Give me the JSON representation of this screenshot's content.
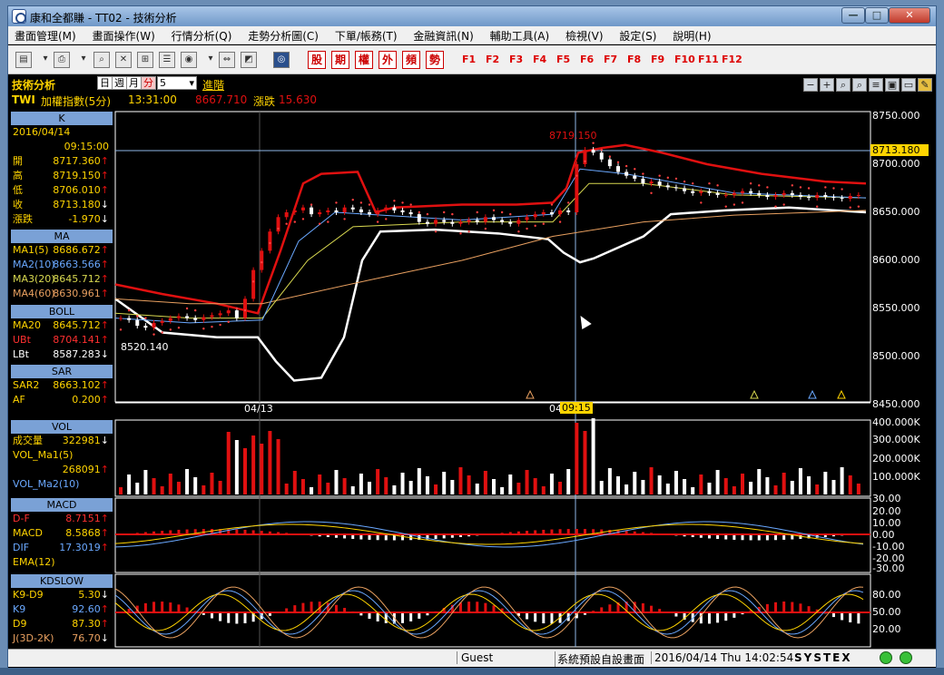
{
  "window": {
    "title": "康和全都賺 - TT02 - 技術分析",
    "controls": {
      "minimize": "—",
      "maximize": "□",
      "close": "✕"
    }
  },
  "menu": [
    "畫面管理(M)",
    "畫面操作(W)",
    "行情分析(Q)",
    "走勢分析圖(C)",
    "下單/帳務(T)",
    "金融資訊(N)",
    "輔助工具(A)",
    "檢視(V)",
    "設定(S)",
    "說明(H)"
  ],
  "toolbar": {
    "red_buttons": [
      "股",
      "期",
      "權",
      "外",
      "頻",
      "勢"
    ],
    "fkeys": [
      "F1",
      "F2",
      "F3",
      "F4",
      "F5",
      "F6",
      "F7",
      "F8",
      "F9",
      "F10",
      "F11",
      "F12"
    ]
  },
  "info": {
    "section_title": "技術分析",
    "periods": [
      "日",
      "週",
      "月",
      "分"
    ],
    "selected_period": "分",
    "interval_value": "5",
    "advanced_label": "進階",
    "symbol": "TWI",
    "instrument": "加權指數(5分)",
    "time": "13:31:00",
    "price": "8667.710",
    "change_label": "漲跌",
    "change_value": "15.630"
  },
  "panels": {
    "k": {
      "title": "K",
      "date": "2016/04/14",
      "time": "09:15:00",
      "rows": [
        {
          "k": "開",
          "v": "8717.360",
          "arrow": "↑"
        },
        {
          "k": "高",
          "v": "8719.150",
          "arrow": "↑"
        },
        {
          "k": "低",
          "v": "8706.010",
          "arrow": "↑"
        },
        {
          "k": "收",
          "v": "8713.180",
          "arrow": "↓"
        },
        {
          "k": "漲跌",
          "v": "-1.970",
          "arrow": "↓"
        }
      ]
    },
    "ma": {
      "title": "MA",
      "rows": [
        {
          "k": "MA1(5)",
          "v": "8686.672",
          "arrow": "↑",
          "color": "#ffd400"
        },
        {
          "k": "MA2(10)",
          "v": "8663.566",
          "arrow": "↑",
          "color": "#6aa8ff"
        },
        {
          "k": "MA3(20)",
          "v": "8645.712",
          "arrow": "↑",
          "color": "#d8d850"
        },
        {
          "k": "MA4(60)",
          "v": "8630.961",
          "arrow": "↑",
          "color": "#e9a060"
        }
      ]
    },
    "boll": {
      "title": "BOLL",
      "rows": [
        {
          "k": "MA20",
          "v": "8645.712",
          "arrow": "↑",
          "color": "#ffd400"
        },
        {
          "k": "UBt",
          "v": "8704.141",
          "arrow": "↑",
          "color": "#ff3030"
        },
        {
          "k": "LBt",
          "v": "8587.283",
          "arrow": "↓",
          "color": "#ffffff"
        }
      ]
    },
    "sar": {
      "title": "SAR",
      "rows": [
        {
          "k": "SAR2",
          "v": "8663.102",
          "arrow": "↑",
          "color": "#ffd400"
        },
        {
          "k": "AF",
          "v": "0.200",
          "arrow": "↑",
          "color": "#ffd400"
        }
      ]
    },
    "vol": {
      "title": "VOL",
      "rows": [
        {
          "k": "成交量",
          "v": "322981",
          "arrow": "↓",
          "color": "#ffd400"
        },
        {
          "k": "VOL_Ma1(5)",
          "v": "",
          "arrow": "",
          "color": "#ffd400"
        },
        {
          "k": "",
          "v": "268091",
          "arrow": "↑",
          "color": "#ffd400"
        },
        {
          "k": "VOL_Ma2(10)",
          "v": "",
          "arrow": "",
          "color": "#6aa8ff"
        }
      ]
    },
    "macd": {
      "title": "MACD",
      "rows": [
        {
          "k": "D-F",
          "v": "8.7151",
          "arrow": "↑",
          "color": "#ff3030"
        },
        {
          "k": "MACD",
          "v": "8.5868",
          "arrow": "↑",
          "color": "#ffd400"
        },
        {
          "k": "DIF",
          "v": "17.3019",
          "arrow": "↑",
          "color": "#6aa8ff"
        },
        {
          "k": "EMA(12)",
          "v": "",
          "arrow": "",
          "color": "#ffd400"
        }
      ]
    },
    "kd": {
      "title": "KDSLOW",
      "rows": [
        {
          "k": "K9-D9",
          "v": "5.30",
          "arrow": "↓",
          "color": "#ffd400"
        },
        {
          "k": "K9",
          "v": "92.60",
          "arrow": "↑",
          "color": "#6aa8ff"
        },
        {
          "k": "D9",
          "v": "87.30",
          "arrow": "↑",
          "color": "#ffd400"
        },
        {
          "k": "J(3D-2K)",
          "v": "76.70",
          "arrow": "↓",
          "color": "#e9a060"
        }
      ]
    }
  },
  "price_axis": {
    "ticks": [
      "8750.000",
      "8700.000",
      "8650.000",
      "8600.000",
      "8550.000",
      "8500.000",
      "8450.000"
    ],
    "current_label": "8713.180"
  },
  "vol_axis": {
    "ticks": [
      "400.000K",
      "300.000K",
      "200.000K",
      "100.000K"
    ]
  },
  "macd_axis": {
    "ticks": [
      "30.00",
      "20.00",
      "10.00",
      "0.00",
      "-10.00",
      "-20.00",
      "-30.00"
    ]
  },
  "kd_axis": {
    "ticks": [
      "80.00",
      "50.00",
      "20.00"
    ]
  },
  "chart_labels": {
    "high_marker": "8719.150",
    "low_marker": "8520.140",
    "date_label": "04/13",
    "cursor_date_prefix": "04",
    "cursor_time": "09:15"
  },
  "status": {
    "user": "Guest",
    "layout": "系統預設自設畫面",
    "datetime": "2016/04/14 Thu 14:02:54",
    "brand": "SYSTEX"
  },
  "colors": {
    "up": "#e01010",
    "down": "#ffffff",
    "boll_upper": "#e01010",
    "boll_lower": "#ffffff",
    "sar": "#ff4040",
    "accent": "#ffd400"
  }
}
